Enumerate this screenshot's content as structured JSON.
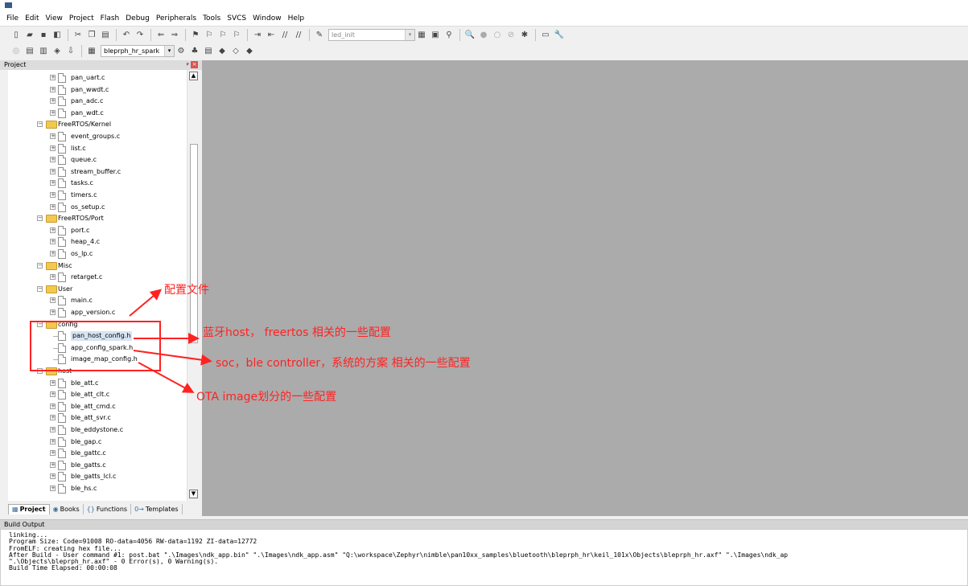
{
  "menu": [
    "File",
    "Edit",
    "View",
    "Project",
    "Flash",
    "Debug",
    "Peripherals",
    "Tools",
    "SVCS",
    "Window",
    "Help"
  ],
  "toolbar1": {
    "find_combo_value": "led_init"
  },
  "toolbar2": {
    "target_combo_value": "bleprph_hr_spark"
  },
  "project_panel": {
    "title": "Project",
    "pin_glyph": "ᵖ",
    "close_glyph": "×",
    "tree": [
      {
        "label": "pan_uart.c"
      },
      {
        "label": "pan_wwdt.c"
      },
      {
        "label": "pan_adc.c"
      },
      {
        "label": "pan_wdt.c"
      },
      {
        "label": "FreeRTOS/Kernel"
      },
      {
        "label": "event_groups.c"
      },
      {
        "label": "list.c"
      },
      {
        "label": "queue.c"
      },
      {
        "label": "stream_buffer.c"
      },
      {
        "label": "tasks.c"
      },
      {
        "label": "timers.c"
      },
      {
        "label": "os_setup.c"
      },
      {
        "label": "FreeRTOS/Port"
      },
      {
        "label": "port.c"
      },
      {
        "label": "heap_4.c"
      },
      {
        "label": "os_lp.c"
      },
      {
        "label": "Misc"
      },
      {
        "label": "retarget.c"
      },
      {
        "label": "User"
      },
      {
        "label": "main.c"
      },
      {
        "label": "app_version.c"
      },
      {
        "label": "config"
      },
      {
        "label": "pan_host_config.h"
      },
      {
        "label": "app_config_spark.h"
      },
      {
        "label": "image_map_config.h"
      },
      {
        "label": "host"
      },
      {
        "label": "ble_att.c"
      },
      {
        "label": "ble_att_clt.c"
      },
      {
        "label": "ble_att_cmd.c"
      },
      {
        "label": "ble_att_svr.c"
      },
      {
        "label": "ble_eddystone.c"
      },
      {
        "label": "ble_gap.c"
      },
      {
        "label": "ble_gattc.c"
      },
      {
        "label": "ble_gatts.c"
      },
      {
        "label": "ble_gatts_lcl.c"
      },
      {
        "label": "ble_hs.c"
      }
    ],
    "tabs": [
      "Project",
      "Books",
      "Functions",
      "Templates"
    ]
  },
  "build_output": {
    "title": "Build Output",
    "lines": [
      "linking...",
      "Program Size: Code=91008 RO-data=4056 RW-data=1192 ZI-data=12772",
      "FromELF: creating hex file...",
      "After Build - User command #1: post.bat \".\\Images\\ndk_app.bin\"  \".\\Images\\ndk_app.asm\" \"Q:\\workspace\\Zephyr\\nimble\\pan10xx_samples\\bluetooth\\bleprph_hr\\keil_101x\\Objects\\bleprph_hr.axf\" \".\\Images\\ndk_ap",
      "\".\\Objects\\bleprph_hr.axf\" - 0 Error(s), 0 Warning(s).",
      "Build Time Elapsed:  00:00:08"
    ]
  },
  "annotations": {
    "config_file": "配置文件",
    "host_config": "蓝牙host， freertos 相关的一些配置",
    "app_config": "soc，ble controller，系统的方案 相关的一些配置",
    "image_map": "OTA image划分的一些配置",
    "color": "#ff2222"
  }
}
